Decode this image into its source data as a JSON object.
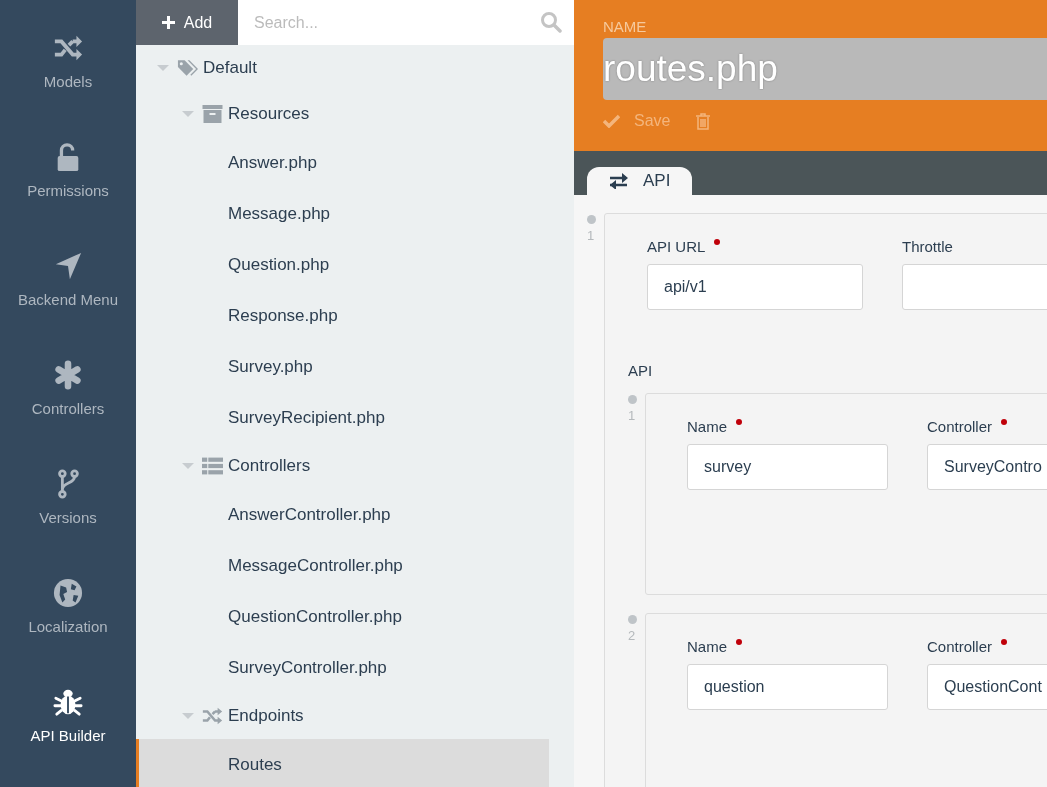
{
  "sidebar": {
    "items": [
      {
        "label": "Models",
        "kind": "models",
        "selected": false
      },
      {
        "label": "Permissions",
        "kind": "permissions",
        "selected": false
      },
      {
        "label": "Backend Menu",
        "kind": "menu",
        "selected": false
      },
      {
        "label": "Controllers",
        "kind": "controllers",
        "selected": false
      },
      {
        "label": "Versions",
        "kind": "versions",
        "selected": false
      },
      {
        "label": "Localization",
        "kind": "localization",
        "selected": false
      },
      {
        "label": "API Builder",
        "kind": "builder",
        "selected": true
      }
    ]
  },
  "toolbar": {
    "add_button": "Add",
    "search": {
      "placeholder": "Search..."
    }
  },
  "tree": [
    {
      "label": "Default",
      "kind": "root",
      "expanded": true,
      "selected": false,
      "children": [
        {
          "label": "Resources",
          "kind": "resources",
          "expanded": true,
          "selected": false,
          "children": [
            {
              "label": "Answer.php",
              "kind": "file",
              "selected": false
            },
            {
              "label": "Message.php",
              "kind": "file",
              "selected": false
            },
            {
              "label": "Question.php",
              "kind": "file",
              "selected": false
            },
            {
              "label": "Response.php",
              "kind": "file",
              "selected": false
            },
            {
              "label": "Survey.php",
              "kind": "file",
              "selected": false
            },
            {
              "label": "SurveyRecipient.php",
              "kind": "file",
              "selected": false
            }
          ]
        },
        {
          "label": "Controllers",
          "kind": "controllers",
          "expanded": true,
          "selected": false,
          "children": [
            {
              "label": "AnswerController.php",
              "kind": "file",
              "selected": false
            },
            {
              "label": "MessageController.php",
              "kind": "file",
              "selected": false
            },
            {
              "label": "QuestionController.php",
              "kind": "file",
              "selected": false
            },
            {
              "label": "SurveyController.php",
              "kind": "file",
              "selected": false
            }
          ]
        },
        {
          "label": "Endpoints",
          "kind": "endpoints",
          "expanded": true,
          "selected": false,
          "children": [
            {
              "label": "Routes",
              "kind": "file",
              "selected": true
            }
          ]
        }
      ]
    }
  ],
  "editor": {
    "name_label": "NAME",
    "name_value": "routes.php",
    "save_button": "Save",
    "tabs": [
      {
        "label": "API",
        "selected": true
      }
    ],
    "repeater": [
      {
        "index": "1",
        "fields": [
          {
            "label": "API URL",
            "required": true,
            "value": "api/v1"
          },
          {
            "label": "Throttle",
            "required": false
          }
        ],
        "section": {
          "label": "API",
          "items": [
            {
              "index": "1",
              "fields": [
                {
                  "label": "Name",
                  "required": true,
                  "value": "survey"
                },
                {
                  "label": "Controller",
                  "required": true,
                  "value": "SurveyContro"
                }
              ]
            },
            {
              "index": "2",
              "fields": [
                {
                  "label": "Name",
                  "required": true,
                  "value": "question"
                },
                {
                  "label": "Controller",
                  "required": true,
                  "value": "QuestionCont"
                }
              ]
            }
          ]
        }
      }
    ]
  }
}
